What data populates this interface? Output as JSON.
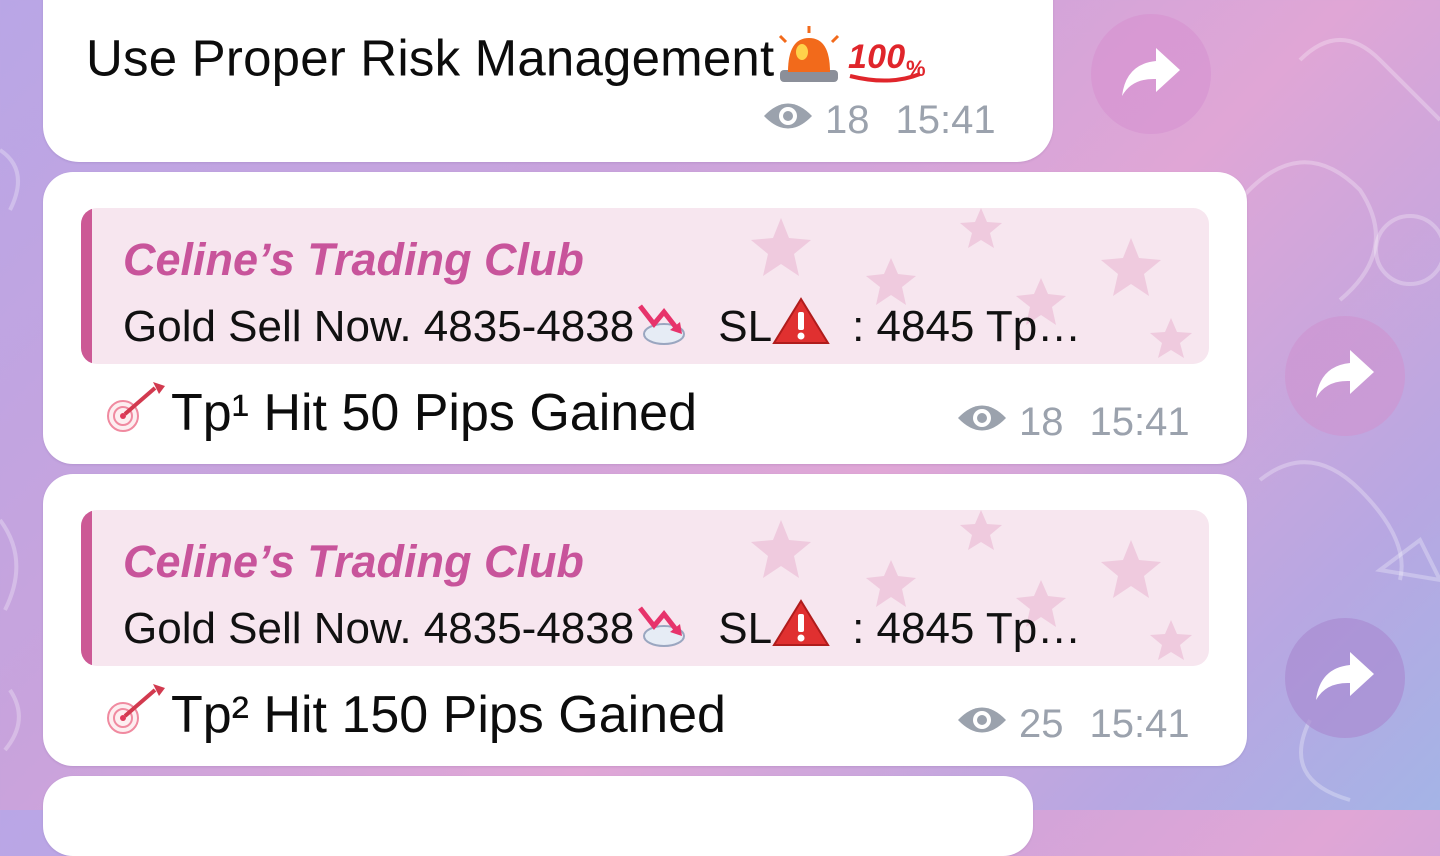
{
  "messages": [
    {
      "text": "Use Proper Risk Management",
      "emoji_icons": [
        "rotating-light-icon",
        "hundred-points-icon"
      ],
      "views": "18",
      "time": "15:41"
    },
    {
      "reply": {
        "author": "Celine’s Trading Club",
        "text_part1": "Gold Sell Now. 4835-4838",
        "text_part2": "SL",
        "text_part3": ": 4845  Tp…"
      },
      "body": "Tp¹ Hit 50 Pips Gained",
      "views": "18",
      "time": "15:41"
    },
    {
      "reply": {
        "author": "Celine’s Trading Club",
        "text_part1": "Gold Sell Now. 4835-4838",
        "text_part2": "SL",
        "text_part3": ": 4845  Tp…"
      },
      "body": "Tp² Hit 150 Pips Gained",
      "views": "25",
      "time": "15:41"
    }
  ],
  "icons": {
    "views": "eye-icon",
    "forward": "share-arrow-icon",
    "target": "direct-hit-icon",
    "chart_down": "chart-decreasing-icon",
    "warning": "warning-icon"
  },
  "colors": {
    "accent": "#cc5995",
    "reply_bg": "#f7e6ef",
    "meta": "#9ba2ad"
  }
}
